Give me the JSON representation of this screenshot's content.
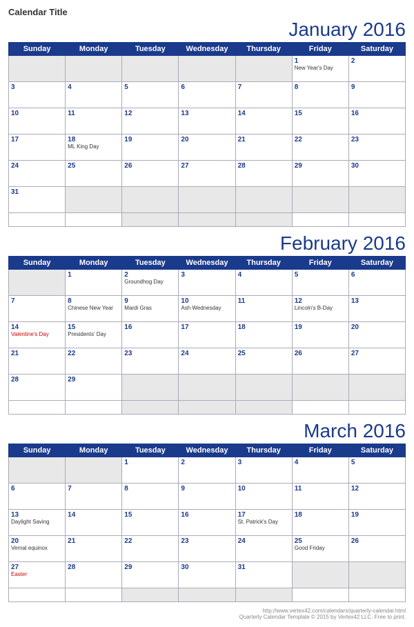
{
  "calendarTitle": "Calendar Title",
  "months": [
    {
      "name": "January 2016",
      "year": 2016,
      "startDay": 5,
      "days": [
        {
          "date": 1,
          "holiday": "New Year's Day",
          "holidayRed": false
        },
        {
          "date": 2,
          "holiday": "",
          "holidayRed": false
        },
        {
          "date": 3,
          "holiday": "",
          "holidayRed": false
        },
        {
          "date": 4,
          "holiday": "",
          "holidayRed": false
        },
        {
          "date": 5,
          "holiday": "",
          "holidayRed": false
        },
        {
          "date": 6,
          "holiday": "",
          "holidayRed": false
        },
        {
          "date": 7,
          "holiday": "",
          "holidayRed": false
        },
        {
          "date": 8,
          "holiday": "",
          "holidayRed": false
        },
        {
          "date": 9,
          "holiday": "",
          "holidayRed": false
        },
        {
          "date": 10,
          "holiday": "",
          "holidayRed": false
        },
        {
          "date": 11,
          "holiday": "",
          "holidayRed": false
        },
        {
          "date": 12,
          "holiday": "",
          "holidayRed": false
        },
        {
          "date": 13,
          "holiday": "",
          "holidayRed": false
        },
        {
          "date": 14,
          "holiday": "",
          "holidayRed": false
        },
        {
          "date": 15,
          "holiday": "",
          "holidayRed": false
        },
        {
          "date": 16,
          "holiday": "",
          "holidayRed": false
        },
        {
          "date": 17,
          "holiday": "",
          "holidayRed": false
        },
        {
          "date": 18,
          "holiday": "ML King Day",
          "holidayRed": false
        },
        {
          "date": 19,
          "holiday": "",
          "holidayRed": false
        },
        {
          "date": 20,
          "holiday": "",
          "holidayRed": false
        },
        {
          "date": 21,
          "holiday": "",
          "holidayRed": false
        },
        {
          "date": 22,
          "holiday": "",
          "holidayRed": false
        },
        {
          "date": 23,
          "holiday": "",
          "holidayRed": false
        },
        {
          "date": 24,
          "holiday": "",
          "holidayRed": false
        },
        {
          "date": 25,
          "holiday": "",
          "holidayRed": false
        },
        {
          "date": 26,
          "holiday": "",
          "holidayRed": false
        },
        {
          "date": 27,
          "holiday": "",
          "holidayRed": false
        },
        {
          "date": 28,
          "holiday": "",
          "holidayRed": false
        },
        {
          "date": 29,
          "holiday": "",
          "holidayRed": false
        },
        {
          "date": 30,
          "holiday": "",
          "holidayRed": false
        },
        {
          "date": 31,
          "holiday": "",
          "holidayRed": false
        }
      ]
    },
    {
      "name": "February 2016",
      "year": 2016,
      "startDay": 1,
      "days": [
        {
          "date": 1,
          "holiday": "",
          "holidayRed": false
        },
        {
          "date": 2,
          "holiday": "Groundhog Day",
          "holidayRed": false
        },
        {
          "date": 3,
          "holiday": "",
          "holidayRed": false
        },
        {
          "date": 4,
          "holiday": "",
          "holidayRed": false
        },
        {
          "date": 5,
          "holiday": "",
          "holidayRed": false
        },
        {
          "date": 6,
          "holiday": "",
          "holidayRed": false
        },
        {
          "date": 7,
          "holiday": "",
          "holidayRed": false
        },
        {
          "date": 8,
          "holiday": "Chinese New Year",
          "holidayRed": false
        },
        {
          "date": 9,
          "holiday": "Mardi Gras",
          "holidayRed": false
        },
        {
          "date": 10,
          "holiday": "Ash Wednesday",
          "holidayRed": false
        },
        {
          "date": 11,
          "holiday": "",
          "holidayRed": false
        },
        {
          "date": 12,
          "holiday": "Lincoln's B-Day",
          "holidayRed": false
        },
        {
          "date": 13,
          "holiday": "",
          "holidayRed": false
        },
        {
          "date": 14,
          "holiday": "Valentine's Day",
          "holidayRed": true
        },
        {
          "date": 15,
          "holiday": "Presidents' Day",
          "holidayRed": false
        },
        {
          "date": 16,
          "holiday": "",
          "holidayRed": false
        },
        {
          "date": 17,
          "holiday": "",
          "holidayRed": false
        },
        {
          "date": 18,
          "holiday": "",
          "holidayRed": false
        },
        {
          "date": 19,
          "holiday": "",
          "holidayRed": false
        },
        {
          "date": 20,
          "holiday": "",
          "holidayRed": false
        },
        {
          "date": 21,
          "holiday": "",
          "holidayRed": false
        },
        {
          "date": 22,
          "holiday": "",
          "holidayRed": false
        },
        {
          "date": 23,
          "holiday": "",
          "holidayRed": false
        },
        {
          "date": 24,
          "holiday": "",
          "holidayRed": false
        },
        {
          "date": 25,
          "holiday": "",
          "holidayRed": false
        },
        {
          "date": 26,
          "holiday": "",
          "holidayRed": false
        },
        {
          "date": 27,
          "holiday": "",
          "holidayRed": false
        },
        {
          "date": 28,
          "holiday": "",
          "holidayRed": false
        },
        {
          "date": 29,
          "holiday": "",
          "holidayRed": false
        }
      ]
    },
    {
      "name": "March 2016",
      "year": 2016,
      "startDay": 2,
      "days": [
        {
          "date": 1,
          "holiday": "",
          "holidayRed": false
        },
        {
          "date": 2,
          "holiday": "",
          "holidayRed": false
        },
        {
          "date": 3,
          "holiday": "",
          "holidayRed": false
        },
        {
          "date": 4,
          "holiday": "",
          "holidayRed": false
        },
        {
          "date": 5,
          "holiday": "",
          "holidayRed": false
        },
        {
          "date": 6,
          "holiday": "",
          "holidayRed": false
        },
        {
          "date": 7,
          "holiday": "",
          "holidayRed": false
        },
        {
          "date": 8,
          "holiday": "",
          "holidayRed": false
        },
        {
          "date": 9,
          "holiday": "",
          "holidayRed": true
        },
        {
          "date": 10,
          "holiday": "",
          "holidayRed": false
        },
        {
          "date": 11,
          "holiday": "",
          "holidayRed": false
        },
        {
          "date": 12,
          "holiday": "",
          "holidayRed": false
        },
        {
          "date": 13,
          "holiday": "Daylight Saving",
          "holidayRed": false
        },
        {
          "date": 14,
          "holiday": "",
          "holidayRed": false
        },
        {
          "date": 15,
          "holiday": "",
          "holidayRed": false
        },
        {
          "date": 16,
          "holiday": "",
          "holidayRed": false
        },
        {
          "date": 17,
          "holiday": "St. Patrick's Day",
          "holidayRed": false
        },
        {
          "date": 18,
          "holiday": "",
          "holidayRed": false
        },
        {
          "date": 19,
          "holiday": "",
          "holidayRed": false
        },
        {
          "date": 20,
          "holiday": "Vernal equinox",
          "holidayRed": false
        },
        {
          "date": 21,
          "holiday": "",
          "holidayRed": false
        },
        {
          "date": 22,
          "holiday": "",
          "holidayRed": false
        },
        {
          "date": 23,
          "holiday": "",
          "holidayRed": false
        },
        {
          "date": 24,
          "holiday": "",
          "holidayRed": false
        },
        {
          "date": 25,
          "holiday": "Good Friday",
          "holidayRed": false
        },
        {
          "date": 26,
          "holiday": "",
          "holidayRed": false
        },
        {
          "date": 27,
          "holiday": "Easter",
          "holidayRed": true
        },
        {
          "date": 28,
          "holiday": "",
          "holidayRed": false
        },
        {
          "date": 29,
          "holiday": "",
          "holidayRed": false
        },
        {
          "date": 30,
          "holiday": "",
          "holidayRed": false
        },
        {
          "date": 31,
          "holiday": "",
          "holidayRed": false
        }
      ]
    }
  ],
  "weekdays": [
    "Sunday",
    "Monday",
    "Tuesday",
    "Wednesday",
    "Thursday",
    "Friday",
    "Saturday"
  ],
  "footer": {
    "url": "http://www.vertex42.com/calendars/quarterly-calendar.html",
    "copy": "Quarterly Calendar Template © 2015 by Vertex42 LLC. Free to print."
  }
}
